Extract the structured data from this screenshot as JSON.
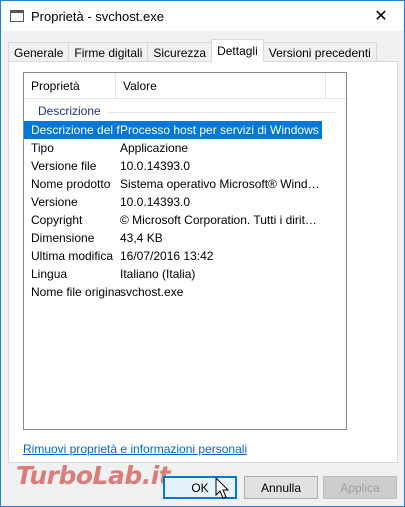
{
  "window": {
    "title": "Proprietà - svchost.exe",
    "close_glyph": "✕"
  },
  "tabs": [
    {
      "label": "Generale"
    },
    {
      "label": "Firme digitali"
    },
    {
      "label": "Sicurezza"
    },
    {
      "label": "Dettagli"
    },
    {
      "label": "Versioni precedenti"
    }
  ],
  "list": {
    "columns": {
      "property": "Proprietà",
      "value": "Valore"
    },
    "group": "Descrizione",
    "rows": [
      {
        "k": "Descrizione del file",
        "v": "Processo host per servizi di Windows"
      },
      {
        "k": "Tipo",
        "v": "Applicazione"
      },
      {
        "k": "Versione file",
        "v": "10.0.14393.0"
      },
      {
        "k": "Nome prodotto",
        "v": "Sistema operativo Microsoft® Window..."
      },
      {
        "k": "Versione",
        "v": "10.0.14393.0"
      },
      {
        "k": "Copyright",
        "v": "© Microsoft Corporation. Tutti i diritti ri..."
      },
      {
        "k": "Dimensione",
        "v": "43,4 KB"
      },
      {
        "k": "Ultima modifica",
        "v": "16/07/2016 13:42"
      },
      {
        "k": "Lingua",
        "v": "Italiano (Italia)"
      },
      {
        "k": "Nome file originale",
        "v": "svchost.exe"
      }
    ]
  },
  "link": "Rimuovi proprietà e informazioni personali",
  "buttons": {
    "ok": "OK",
    "cancel": "Annulla",
    "apply": "Applica"
  },
  "watermark": "TurboLab.it",
  "colors": {
    "selection": "#0078d7",
    "group_label": "#1e3287",
    "link": "#0066cc"
  }
}
